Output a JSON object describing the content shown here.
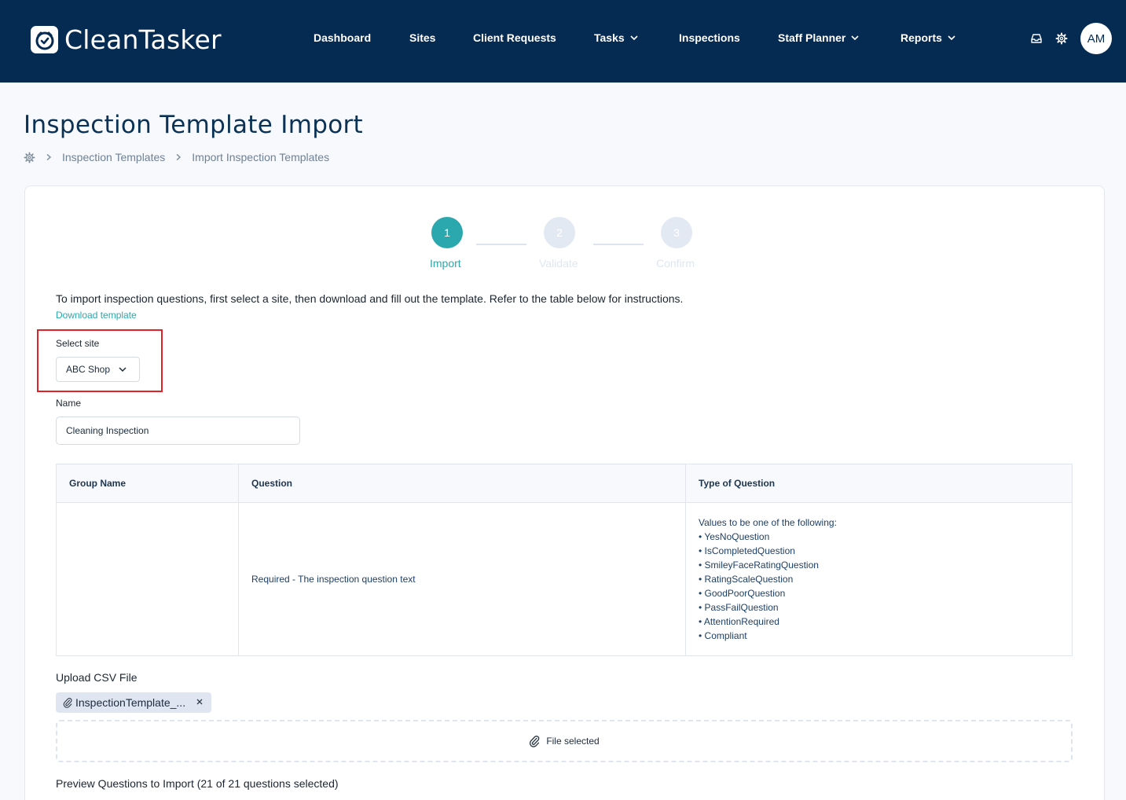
{
  "nav": {
    "brand": "CleanTasker",
    "items": [
      {
        "label": "Dashboard"
      },
      {
        "label": "Sites"
      },
      {
        "label": "Client Requests"
      },
      {
        "label": "Tasks"
      },
      {
        "label": "Inspections"
      },
      {
        "label": "Staff Planner"
      },
      {
        "label": "Reports"
      }
    ],
    "icons": [
      "inbox-icon",
      "gear-icon"
    ],
    "avatar_initials": "AM"
  },
  "page": {
    "title": "Inspection Template Import",
    "breadcrumb": [
      "Inspection Templates",
      "Import Inspection Templates"
    ]
  },
  "stepper": {
    "steps": [
      {
        "number": "1",
        "label": "Import",
        "state": "active"
      },
      {
        "number": "2",
        "label": "Validate",
        "state": "inactive"
      },
      {
        "number": "3",
        "label": "Confirm",
        "state": "inactive"
      }
    ]
  },
  "form": {
    "instructions": "To import inspection questions, first select a site, then download and fill out the template. Refer to the table below for instructions.",
    "download_link": "Download template",
    "site_label": "Select site",
    "site_value": "ABC Shop",
    "name_label": "Name",
    "name_value": "Cleaning Inspection"
  },
  "table": {
    "headers": [
      "Group Name",
      "Question",
      "Type of Question"
    ],
    "row": {
      "group_name": "",
      "question": "Required - The inspection question text",
      "type_intro": "Values to be one of the following:",
      "types": [
        "YesNoQuestion",
        "IsCompletedQuestion",
        "SmileyFaceRatingQuestion",
        "RatingScaleQuestion",
        "GoodPoorQuestion",
        "PassFailQuestion",
        "AttentionRequired",
        "Compliant"
      ]
    }
  },
  "upload": {
    "label": "Upload CSV File",
    "file_name": "InspectionTemplate_...",
    "dropzone_text": "File selected"
  },
  "preview": {
    "heading": "Preview Questions to Import (21 of 21 questions selected)"
  },
  "colors": {
    "nav_background": "#062b52",
    "accent": "#2aa8ad",
    "highlight": "#e0232a"
  }
}
